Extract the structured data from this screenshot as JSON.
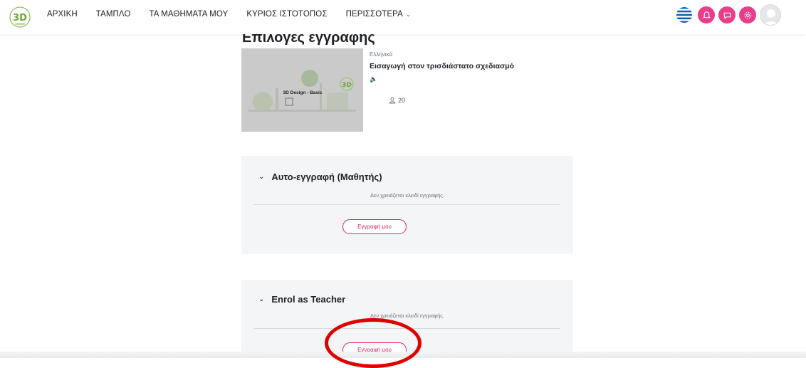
{
  "nav": {
    "items": [
      {
        "label": "ΑΡΧΙΚΗ"
      },
      {
        "label": "ΤΑΜΠΛΟ"
      },
      {
        "label": "ΤΑ ΜΑΘΗΜΑΤΑ ΜΟΥ"
      },
      {
        "label": "ΚΥΡΙΟΣ ΙΣΤΟΤΟΠΟΣ"
      },
      {
        "label": "ΠΕΡΙΣΣΟΤΕΡΑ"
      }
    ],
    "more_icon": "chevron-down-icon"
  },
  "header_icons": [
    "greek-flag-icon",
    "notifications-icon",
    "messages-icon",
    "settings-icon",
    "user-avatar-icon"
  ],
  "colors": {
    "accent": "#e83e8c",
    "enrol_button": "#e0245e",
    "panel_bg": "#f4f5f6",
    "annotation": "#e00000"
  },
  "page": {
    "title": "Επιλογές εγγραφής"
  },
  "course": {
    "thumbnail_text": "3D Design - Basic",
    "language": "Ελληνικά",
    "name": "Εισαγωγή στον τρισδιάστατο σχεδιασμό",
    "participants": "20"
  },
  "enrolments": [
    {
      "title": "Αυτο-εγγραφή (Μαθητής)",
      "note": "Δεν χρειάζεται κλειδί εγγραφής.",
      "button": "Εγγραφή μου"
    },
    {
      "title": "Enrol as Teacher",
      "note": "Δεν χρειάζεται κλειδί εγγραφής.",
      "button": "Εγγραφή μου"
    }
  ]
}
